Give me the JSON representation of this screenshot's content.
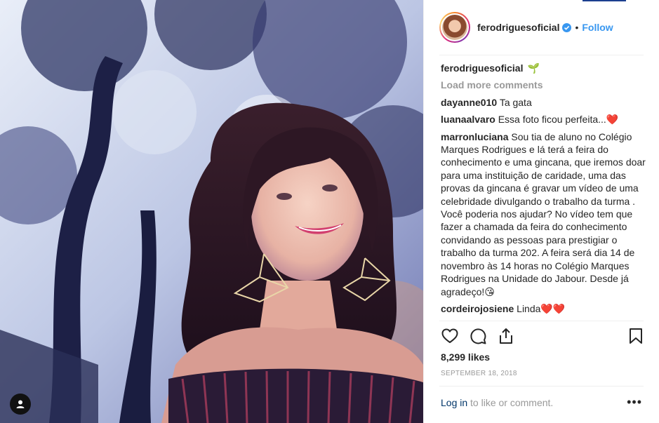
{
  "post": {
    "username": "ferodriguesoficial",
    "dot": "•",
    "follow_label": "Follow",
    "caption_emoji": "🌱",
    "load_more": "Load more comments",
    "comments": [
      {
        "user": "dayanne010",
        "text": "Ta gata"
      },
      {
        "user": "luanaalvaro",
        "text": "Essa foto ficou perfeita...❤️"
      },
      {
        "user": "marronluciana",
        "text": "Sou tia de aluno no Colégio Marques Rodrigues e lá terá a feira do conhecimento e uma gincana, que iremos doar para uma instituição de caridade, uma das provas da gincana é gravar um vídeo de uma celebridade divulgando o trabalho da turma . Você poderia nos ajudar? No vídeo tem que fazer a chamada da feira do conhecimento convidando as pessoas para prestigiar o trabalho da turma 202. A feira será dia 14 de novembro às 14 horas no Colégio Marques Rodrigues na Unidade do Jabour. Desde já agradeço!😘"
      },
      {
        "user": "cordeirojosiene",
        "text": "Linda❤️❤️"
      }
    ],
    "likes": "8,299 likes",
    "date": "SEPTEMBER 18, 2018",
    "login_link": "Log in",
    "login_rest": " to like or comment.",
    "more_label": "•••"
  },
  "icons": {
    "like": "heart-icon",
    "comment": "comment-icon",
    "share": "share-icon",
    "save": "bookmark-icon",
    "verified": "verified-badge-icon"
  },
  "colors": {
    "accent": "#3897f0",
    "muted": "#999999",
    "text": "#262626",
    "link_dark": "#003569"
  }
}
